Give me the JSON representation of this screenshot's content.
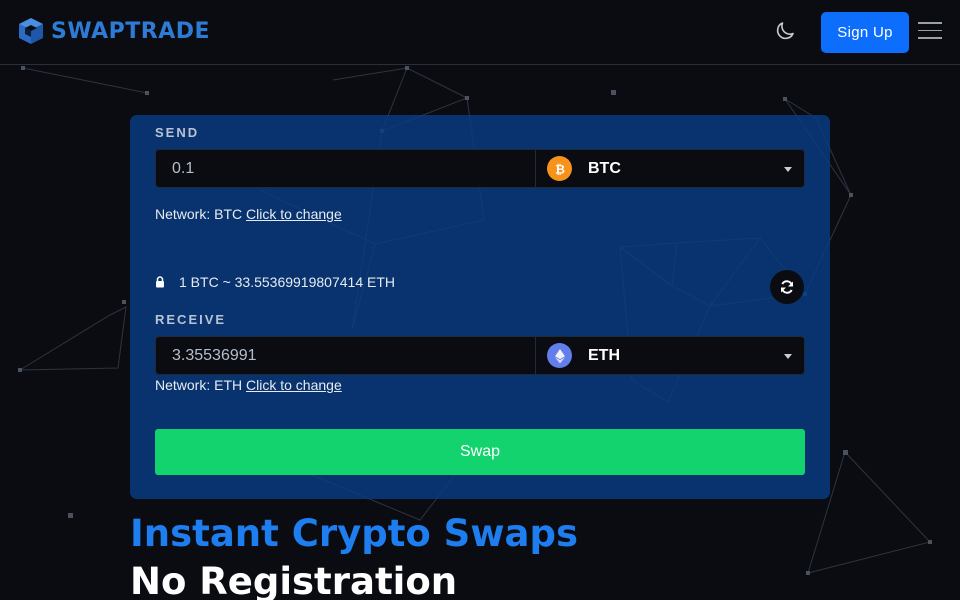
{
  "header": {
    "brand": "SWAPTRADE",
    "signup_label": "Sign Up"
  },
  "swap": {
    "send": {
      "label": "SEND",
      "amount": "0.1",
      "coin": "BTC",
      "network_prefix": "Network: BTC",
      "change_link": "Click to change"
    },
    "rate": "1 BTC ~ 33.55369919807414 ETH",
    "receive": {
      "label": "RECEIVE",
      "amount": "3.35536991",
      "coin": "ETH",
      "network_prefix": "Network: ETH",
      "change_link": "Click to change"
    },
    "swap_label": "Swap"
  },
  "hero": {
    "title": "Instant Crypto Swaps",
    "subtitle": "No Registration"
  },
  "colors": {
    "brand": "#2e7bd6",
    "primary": "#0d6efd",
    "swap_button": "#12d36e",
    "card": "#0a3c82",
    "btc": "#f7931a",
    "eth": "#627eea"
  },
  "icons": {
    "logo": "cube-logo-icon",
    "theme": "moon-icon",
    "menu": "hamburger-menu-icon",
    "lock": "lock-icon",
    "refresh": "refresh-icon",
    "send_coin": "bitcoin-icon",
    "receive_coin": "ethereum-icon"
  }
}
